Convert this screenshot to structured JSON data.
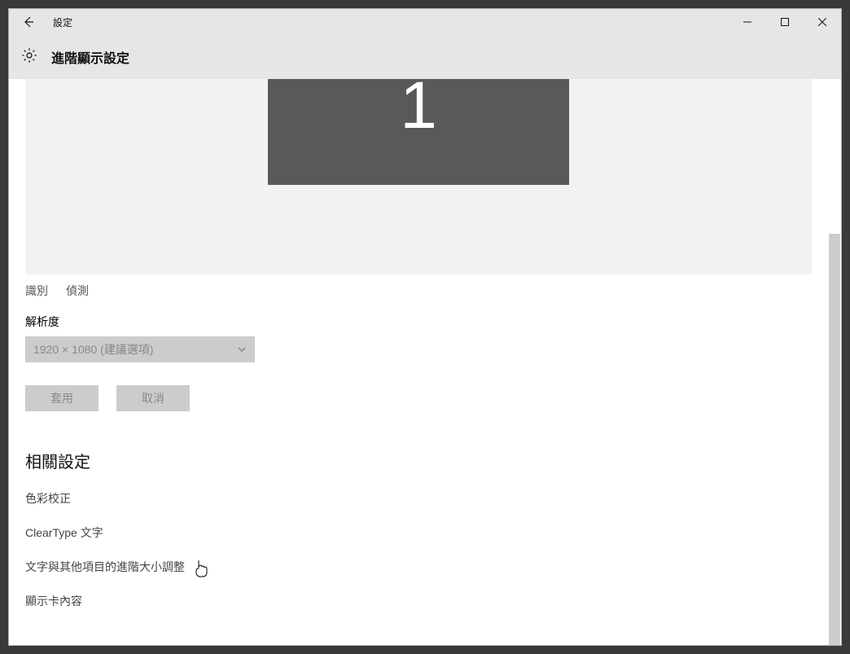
{
  "window": {
    "title": "設定"
  },
  "subheader": {
    "title": "進階顯示設定"
  },
  "monitor": {
    "number": "1"
  },
  "identify": "識別",
  "detect": "偵測",
  "resolution_label": "解析度",
  "resolution_value": "1920 × 1080 (建議選項)",
  "apply_label": "套用",
  "cancel_label": "取消",
  "related_heading": "相關設定",
  "links": {
    "color_calibration": "色彩校正",
    "cleartype": "ClearType 文字",
    "advanced_sizing": "文字與其他項目的進階大小調整",
    "display_adapter": "顯示卡內容"
  }
}
